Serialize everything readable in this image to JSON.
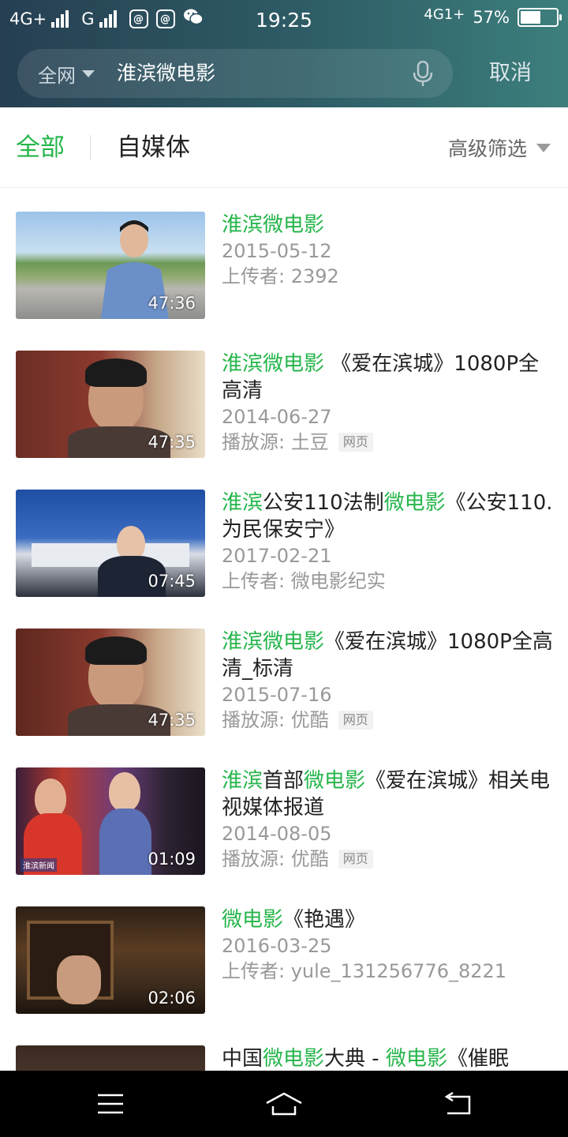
{
  "status_bar": {
    "left_network_1": "4G+",
    "left_network_2": "G",
    "app_icon_1": "@",
    "app_icon_2": "@",
    "time": "19:25",
    "right_network": "4G1+",
    "battery_percent_text": "57%",
    "battery_level": 0.57,
    "icons": [
      "signal-icon",
      "qq-mail-icon",
      "qq-mail-icon",
      "wechat-icon",
      "battery-icon"
    ]
  },
  "search": {
    "scope_label": "全网",
    "query": "淮滨微电影",
    "cancel_label": "取消"
  },
  "tabs": {
    "all": "全部",
    "self_media": "自媒体",
    "filter": "高级筛选"
  },
  "results": [
    {
      "title_parts": [
        {
          "text": "淮滨微电影",
          "hl": true
        }
      ],
      "duration": "47:36",
      "date": "2015-05-12",
      "meta": "上传者: 2392",
      "badge": ""
    },
    {
      "title_parts": [
        {
          "text": "淮滨微电影",
          "hl": true
        },
        {
          "text": " 《爱在滨城》1080P全高清",
          "hl": false
        }
      ],
      "duration": "47:35",
      "date": "2014-06-27",
      "meta": "播放源: 土豆",
      "badge": "网页"
    },
    {
      "title_parts": [
        {
          "text": "淮滨",
          "hl": true
        },
        {
          "text": "公安110法制",
          "hl": false
        },
        {
          "text": "微电影",
          "hl": true
        },
        {
          "text": "《公安110.为民保安宁》",
          "hl": false
        }
      ],
      "duration": "07:45",
      "date": "2017-02-21",
      "meta": "上传者: 微电影纪实",
      "badge": ""
    },
    {
      "title_parts": [
        {
          "text": "淮滨微电影",
          "hl": true
        },
        {
          "text": "《爱在滨城》1080P全高清_标清",
          "hl": false
        }
      ],
      "duration": "47:35",
      "date": "2015-07-16",
      "meta": "播放源: 优酷",
      "badge": "网页"
    },
    {
      "title_parts": [
        {
          "text": "淮滨",
          "hl": true
        },
        {
          "text": "首部",
          "hl": false
        },
        {
          "text": "微电影",
          "hl": true
        },
        {
          "text": "《爱在滨城》相关电视媒体报道",
          "hl": false
        }
      ],
      "duration": "01:09",
      "date": "2014-08-05",
      "meta": "播放源: 优酷",
      "badge": "网页",
      "thumb_tag": "淮滨新闻"
    },
    {
      "title_parts": [
        {
          "text": "微电影",
          "hl": true
        },
        {
          "text": "《艳遇》",
          "hl": false
        }
      ],
      "duration": "02:06",
      "date": "2016-03-25",
      "meta": "上传者: yule_131256776_8221",
      "badge": ""
    },
    {
      "title_parts": [
        {
          "text": "中国",
          "hl": false
        },
        {
          "text": "微电影",
          "hl": true
        },
        {
          "text": "大典 - ",
          "hl": false
        },
        {
          "text": "微电影",
          "hl": true
        },
        {
          "text": "《催眠",
          "hl": false
        }
      ],
      "duration": "",
      "date": "",
      "meta": "",
      "badge": ""
    }
  ],
  "colors": {
    "accent_green": "#25b54a",
    "header_left": "#263f52",
    "header_right": "#3d7f7d",
    "muted_text": "#999999"
  },
  "nav": {
    "icons": [
      "menu-icon",
      "home-icon",
      "back-icon"
    ]
  }
}
